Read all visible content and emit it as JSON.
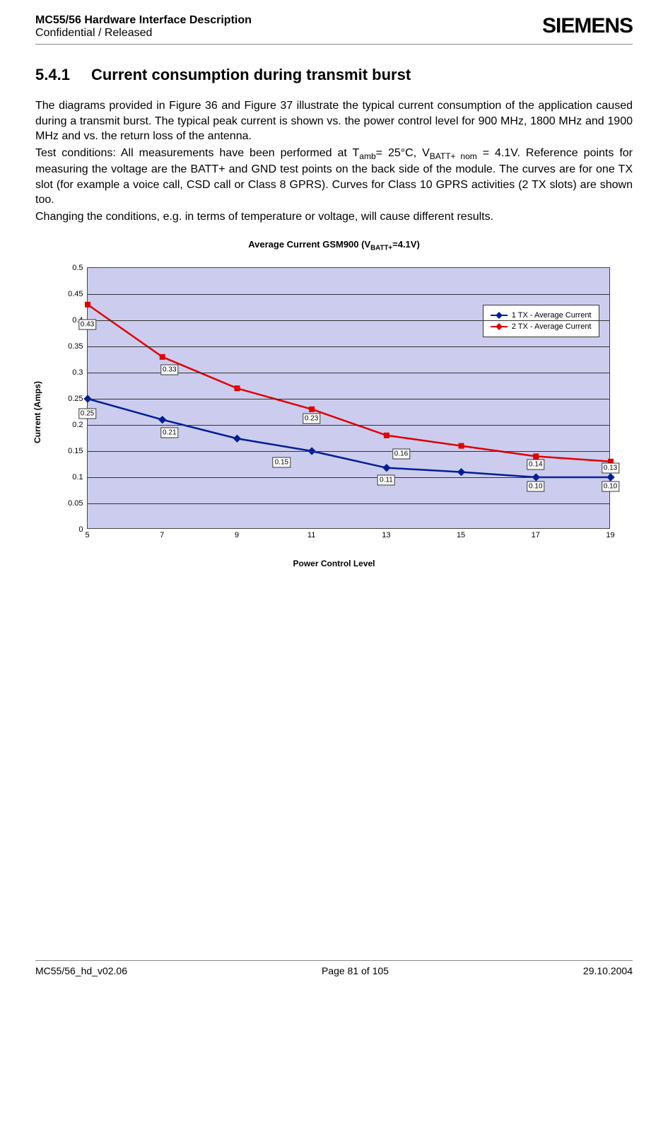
{
  "header": {
    "title": "MC55/56 Hardware Interface Description",
    "status": "Confidential / Released",
    "logo": "SIEMENS"
  },
  "section": {
    "number": "5.4.1",
    "title": "Current consumption during transmit burst"
  },
  "paragraphs": {
    "p1": "The diagrams provided in Figure 36 and Figure 37 illustrate the typical current consumption of the application caused during a transmit burst. The typical peak current is shown vs. the power control level for 900 MHz, 1800 MHz and 1900 MHz and vs. the return loss of the antenna.",
    "p2a": "Test conditions: All measurements have been performed at T",
    "p2a_sub": "amb",
    "p2b": "= 25°C, V",
    "p2b_sub": "BATT+ nom",
    "p2c": " = 4.1V. Reference points for measuring the voltage are the BATT+ and GND test points on the back side of the module. The curves are for one TX slot (for example a voice call, CSD call or Class 8 GPRS). Curves for Class 10 GPRS activities (2 TX slots) are shown too.",
    "p3": "Changing the conditions, e.g. in terms of temperature or voltage, will cause different results."
  },
  "chart_title": {
    "pre": "Average Current GSM900 (V",
    "sub": "BATT+",
    "post": "=4.1V)"
  },
  "chart_data": {
    "type": "line",
    "xlabel": "Power Control Level",
    "ylabel": "Current (Amps)",
    "xlim": [
      5,
      19
    ],
    "ylim": [
      0,
      0.5
    ],
    "xticks": [
      5,
      7,
      9,
      11,
      13,
      15,
      17,
      19
    ],
    "yticks": [
      0,
      0.05,
      0.1,
      0.15,
      0.2,
      0.25,
      0.3,
      0.35,
      0.4,
      0.45,
      0.5
    ],
    "legend": [
      "1 TX - Average Current",
      "2 TX - Average Current"
    ],
    "series": [
      {
        "name": "1 TX - Average Current",
        "color": "#001e96",
        "x": [
          5,
          7,
          9,
          11,
          13,
          15,
          17,
          19
        ],
        "y": [
          0.25,
          0.21,
          0.174,
          0.15,
          0.118,
          0.11,
          0.1,
          0.1
        ]
      },
      {
        "name": "2 TX - Average Current",
        "color": "#e00000",
        "x": [
          5,
          7,
          9,
          11,
          13,
          15,
          17,
          19
        ],
        "y": [
          0.43,
          0.33,
          0.27,
          0.23,
          0.18,
          0.16,
          0.14,
          0.13
        ]
      }
    ],
    "labels": [
      {
        "text": "0.25",
        "x": 5,
        "y_pos": 0.222
      },
      {
        "text": "0.21",
        "x": 7.2,
        "y_pos": 0.185
      },
      {
        "text": "0.15",
        "x": 10.2,
        "y_pos": 0.128
      },
      {
        "text": "0.11",
        "x": 13,
        "y_pos": 0.095
      },
      {
        "text": "0.10",
        "x": 17,
        "y_pos": 0.082
      },
      {
        "text": "0.10",
        "x": 19,
        "y_pos": 0.082
      },
      {
        "text": "0.43",
        "x": 5,
        "y_pos": 0.392
      },
      {
        "text": "0.33",
        "x": 7.2,
        "y_pos": 0.305
      },
      {
        "text": "0.23",
        "x": 11,
        "y_pos": 0.212
      },
      {
        "text": "0.16",
        "x": 13.4,
        "y_pos": 0.145
      },
      {
        "text": "0.14",
        "x": 17,
        "y_pos": 0.125
      },
      {
        "text": "0.13",
        "x": 19,
        "y_pos": 0.118
      }
    ]
  },
  "footer": {
    "left": "MC55/56_hd_v02.06",
    "center": "Page 81 of 105",
    "right": "29.10.2004"
  }
}
